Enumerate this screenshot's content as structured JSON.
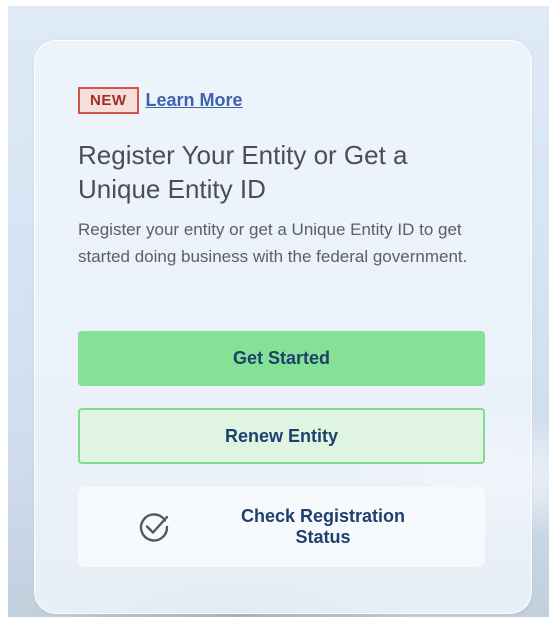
{
  "colors": {
    "primary_button": "#84e196",
    "secondary_button_bg": "#dff5e2",
    "secondary_button_border": "#7fdc8f",
    "button_text": "#1f3f6c",
    "badge_border": "#d5524a",
    "badge_text": "#a12f26",
    "link": "#3d62b0"
  },
  "card": {
    "badge": "NEW",
    "learn_more_link": "Learn More",
    "title": "Register Your Entity or Get a Unique Entity ID",
    "description": "Register your entity or get a Unique Entity ID to get started doing business with the federal government.",
    "get_started_button": "Get Started",
    "renew_entity_button": "Renew Entity",
    "check_status": {
      "icon": "check-circle-icon",
      "label": "Check Registration Status"
    }
  }
}
